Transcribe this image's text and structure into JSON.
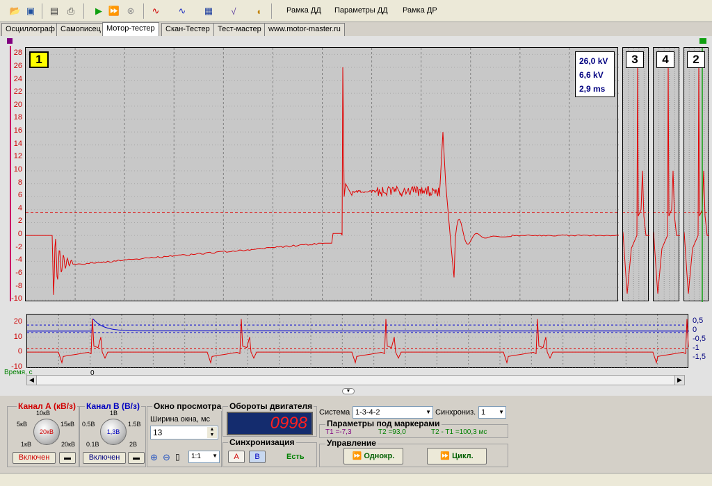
{
  "toolbar": {
    "buttons": [
      "open-icon",
      "save-icon",
      "print-preview-icon",
      "print-icon",
      "play-icon",
      "play-fast-icon",
      "stop-icon",
      "waveform-a-icon",
      "waveform-b-icon",
      "calculator-icon",
      "sqrt-icon",
      "speaker-icon"
    ],
    "labels": [
      "Рамка ДД",
      "Параметры ДД",
      "Рамка ДР"
    ]
  },
  "tabs": [
    "Осциллограф",
    "Самописец",
    "Мотор-тестер",
    "Скан-Тестер",
    "Тест-мастер",
    "www.motor-master.ru"
  ],
  "active_tab": 2,
  "scope": {
    "cylinder_main": "1",
    "cylinders": [
      "3",
      "4",
      "2"
    ],
    "readout": [
      "26,0 kV",
      "6,6 kV",
      "2,9 ms"
    ],
    "y_ticks": [
      "28",
      "26",
      "24",
      "22",
      "20",
      "18",
      "16",
      "14",
      "12",
      "10",
      "8",
      "6",
      "4",
      "2",
      "0",
      "-2",
      "-4",
      "-6",
      "-8",
      "-10"
    ],
    "sub_left_ticks": [
      "20",
      "10",
      "0",
      "-10"
    ],
    "sub_right_ticks": [
      "0,5",
      "0",
      "-0,5",
      "-1",
      "-1,5"
    ],
    "time_label": "Время, с",
    "time_zero": "0",
    "colors": {
      "trace": "#e00000",
      "trace_b": "#0000d0",
      "grid": "#808080",
      "bg": "#c8c8c8"
    }
  },
  "bottom": {
    "channel_a": {
      "title": "Канал А (кВ/з)",
      "knob_value": "20кВ",
      "labels": {
        "top": "10кВ",
        "left": "5кВ",
        "right": "15кВ",
        "bl": "1кВ",
        "br": "20кВ"
      },
      "button": "Включен"
    },
    "channel_b": {
      "title": "Канал В (В/з)",
      "knob_value": "1,3В",
      "labels": {
        "top": "1В",
        "left": "0.5В",
        "right": "1.5В",
        "bl": "0.1В",
        "br": "2В"
      },
      "button": "Включен"
    },
    "view_window": {
      "title": "Окно просмотра",
      "width_label": "Ширина окна, мс",
      "width_value": "13",
      "zoom_value": "1:1"
    },
    "rpm": {
      "title": "Обороты двигателя",
      "value": "0998"
    },
    "sync": {
      "title": "Синхронизация",
      "btn_a": "A",
      "btn_b": "B",
      "state": "Есть"
    },
    "system": {
      "label": "Система",
      "value": "1-3-4-2",
      "sync_label": "Синхрониз.",
      "sync_value": "1"
    },
    "markers": {
      "title": "Параметры под маркерами",
      "t1": "T1 =-7,3",
      "t2": "T2 =93,0",
      "diff": "T2 - T1 =100,3 мс"
    },
    "control": {
      "title": "Управление",
      "single": "Однокр.",
      "cycle": "Цикл."
    }
  }
}
